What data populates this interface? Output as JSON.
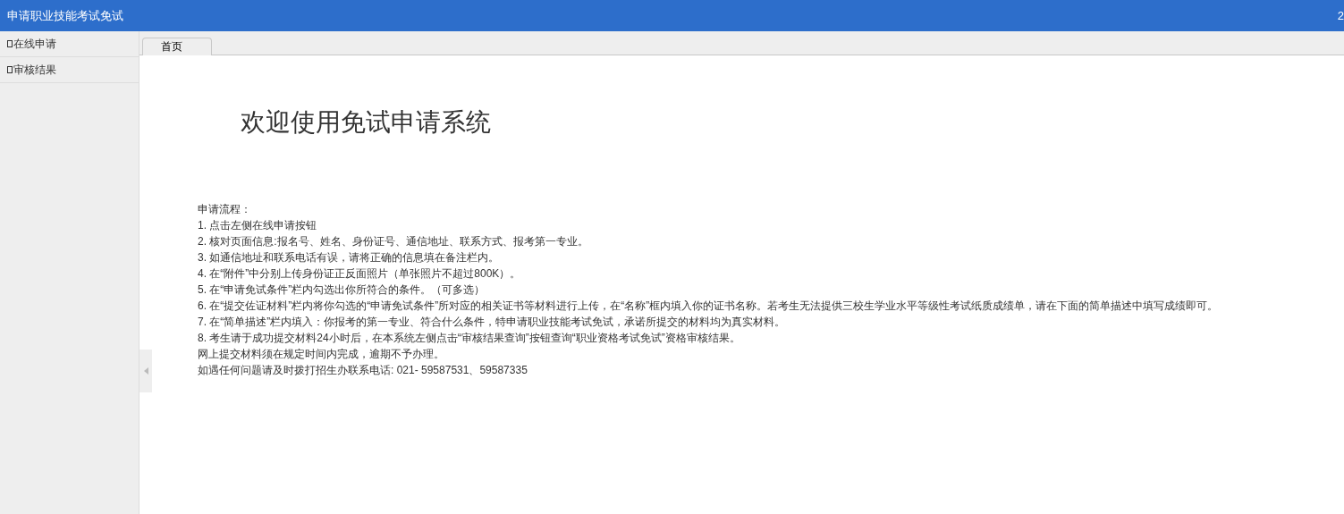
{
  "header": {
    "title": "申请职业技能考试免试",
    "user": "2"
  },
  "sidebar": {
    "items": [
      {
        "label": "在线申请"
      },
      {
        "label": "审核结果"
      }
    ]
  },
  "tabs": [
    {
      "label": "首页",
      "selected": true
    }
  ],
  "content": {
    "heading": "欢迎使用免试申请系统",
    "lines": [
      "申请流程：",
      "1. 点击左侧在线申请按钮",
      "2. 核对页面信息:报名号、姓名、身份证号、通信地址、联系方式、报考第一专业。",
      "3. 如通信地址和联系电话有误，请将正确的信息填在备注栏内。",
      "4. 在“附件”中分别上传身份证正反面照片（单张照片不超过800K）。",
      "5. 在“申请免试条件”栏内勾选出你所符合的条件。（可多选）",
      "6.  在“提交佐证材料”栏内将你勾选的“申请免试条件”所对应的相关证书等材料进行上传，在“名称”框内填入你的证书名称。若考生无法提供三校生学业水平等级性考试纸质成绩单，请在下面的简单描述中填写成绩即可。",
      "7. 在“简单描述”栏内填入：你报考的第一专业、符合什么条件，特申请职业技能考试免试，承诺所提交的材料均为真实材料。",
      "8. 考生请于成功提交材料24小时后，在本系统左侧点击“审核结果查询”按钮查询“职业资格考试免试”资格审核结果。",
      "网上提交材料须在规定时间内完成，逾期不予办理。",
      "如遇任何问题请及时拨打招生办联系电话: 021- 59587531、59587335"
    ]
  }
}
